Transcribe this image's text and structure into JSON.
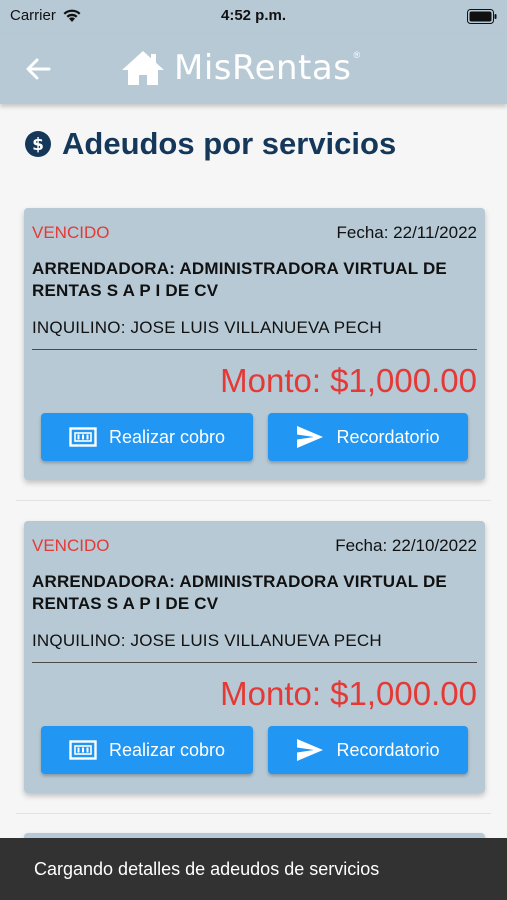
{
  "status_bar": {
    "carrier": "Carrier",
    "time": "4:52 p.m.",
    "icons": [
      "wifi-icon",
      "battery-icon"
    ]
  },
  "header": {
    "back_icon": "arrow-left-icon",
    "logo_icon": "house-icon",
    "brand": "MisRentas",
    "registered": "®"
  },
  "page": {
    "title_icon": "dollar-circle-icon",
    "title": "Adeudos por servicios"
  },
  "cards": [
    {
      "status": "VENCIDO",
      "date": "Fecha: 22/11/2022",
      "landlord": "ARRENDADORA: ADMINISTRADORA VIRTUAL DE RENTAS S A P I DE CV",
      "tenant": "INQUILINO: JOSE LUIS VILLANUEVA PECH",
      "amount": "Monto: $1,000.00",
      "charge_label": "Realizar cobro",
      "reminder_label": "Recordatorio"
    },
    {
      "status": "VENCIDO",
      "date": "Fecha: 22/10/2022",
      "landlord": "ARRENDADORA: ADMINISTRADORA VIRTUAL DE RENTAS S A P I DE CV",
      "tenant": "INQUILINO: JOSE LUIS VILLANUEVA PECH",
      "amount": "Monto: $1,000.00",
      "charge_label": "Realizar cobro",
      "reminder_label": "Recordatorio"
    }
  ],
  "toast": {
    "message": "Cargando detalles de adeudos de servicios"
  },
  "colors": {
    "header_bg": "#b6c9d5",
    "title": "#15385a",
    "overdue": "#e53935",
    "button": "#2196f3",
    "toast_bg": "#323232"
  }
}
